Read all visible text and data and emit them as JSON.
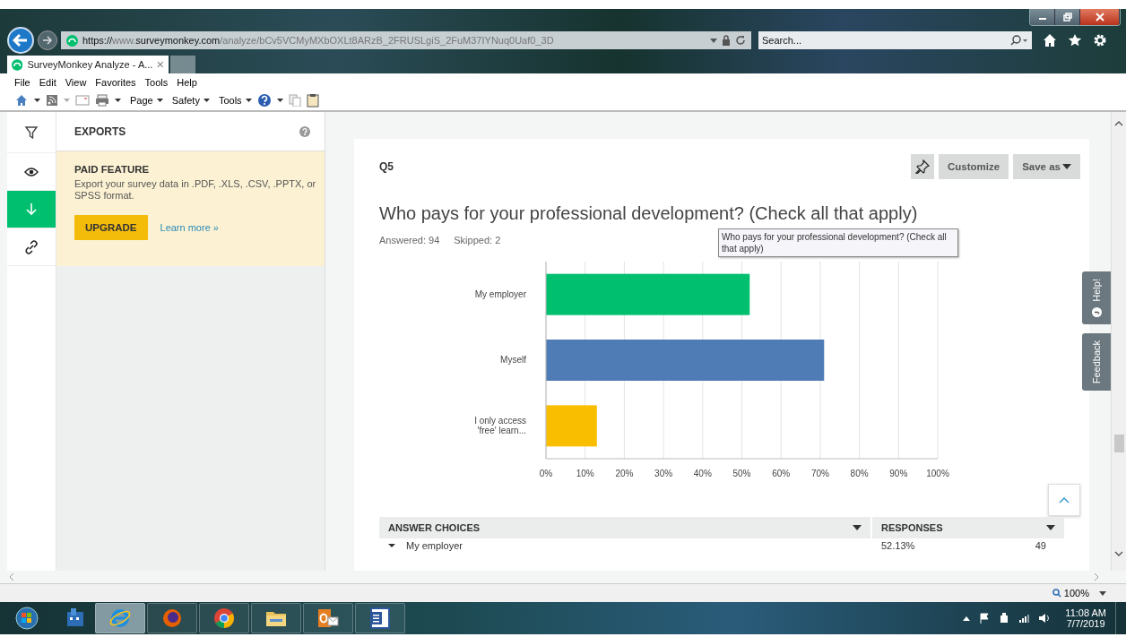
{
  "browser": {
    "url_parts": [
      {
        "text": "https://",
        "emphasized": true
      },
      {
        "text": "www.",
        "emphasized": false
      },
      {
        "text": "surveymonkey.com",
        "emphasized": true
      },
      {
        "text": "/analyze/bCv5VCMyMXbOXLt8ARzB_2FRUSLgiS_2FuM37IYNuq0Uaf0_3D",
        "emphasized": false
      }
    ],
    "search": {
      "placeholder": "Search..."
    },
    "tabs": [
      {
        "label": "SurveyMonkey Analyze - A...",
        "selected": true
      }
    ],
    "menu": [
      "File",
      "Edit",
      "View",
      "Favorites",
      "Tools",
      "Help"
    ],
    "commands": [
      "Page",
      "Safety",
      "Tools"
    ]
  },
  "rail": [
    {
      "kind": "filter",
      "selected": false
    },
    {
      "kind": "eye",
      "selected": false
    },
    {
      "kind": "download",
      "selected": true
    },
    {
      "kind": "link",
      "selected": false
    }
  ],
  "panel": {
    "title": "EXPORTS",
    "notice": {
      "title": "PAID FEATURE",
      "text": "Export your survey data in .PDF, .XLS, .CSV, .PPTX, or SPSS format.",
      "button": "UPGRADE",
      "link": "Learn more »"
    }
  },
  "question": {
    "number": "Q5",
    "actions": [
      "Customize",
      "Save as"
    ],
    "title": "Who pays for your professional development? (Check all that apply)",
    "answered": "Answered: 94",
    "skipped": "Skipped: 2",
    "tooltip": "Who pays for your professional development? (Check all that apply)",
    "chart_data": {
      "type": "bar",
      "orientation": "horizontal",
      "categories": [
        "My employer",
        "Myself",
        "I only access 'free' learn..."
      ],
      "values": [
        52,
        71,
        13
      ],
      "grid": true,
      "colors": [
        "#00bf6f",
        "#507cb6",
        "#f9be00"
      ],
      "xlim": [
        0,
        100
      ],
      "xticks": [
        {
          "value": 0,
          "label": "0%"
        },
        {
          "value": 10,
          "label": "10%"
        },
        {
          "value": 20,
          "label": "20%"
        },
        {
          "value": 30,
          "label": "30%"
        },
        {
          "value": 40,
          "label": "40%"
        },
        {
          "value": 50,
          "label": "50%"
        },
        {
          "value": 60,
          "label": "60%"
        },
        {
          "value": 70,
          "label": "70%"
        },
        {
          "value": 80,
          "label": "80%"
        },
        {
          "value": 90,
          "label": "90%"
        },
        {
          "value": 100,
          "label": "100%"
        }
      ]
    },
    "table": {
      "columns": [
        "ANSWER CHOICES",
        "RESPONSES"
      ],
      "rows": [
        {
          "choice": "My employer",
          "percent": "52.13%",
          "count": "49"
        }
      ]
    }
  },
  "side_tabs": [
    "Help!",
    "Feedback"
  ],
  "status_bar": {
    "zoom": "100%"
  },
  "taskbar": {
    "apps": [
      {
        "kind": "server",
        "selected": false
      },
      {
        "kind": "ie",
        "selected": true
      },
      {
        "kind": "firefox",
        "selected": false
      },
      {
        "kind": "chrome",
        "selected": false
      },
      {
        "kind": "folder",
        "selected": false
      },
      {
        "kind": "outlook",
        "selected": false
      },
      {
        "kind": "word",
        "selected": false
      }
    ],
    "time": "11:08 AM",
    "date": "7/7/2019"
  }
}
